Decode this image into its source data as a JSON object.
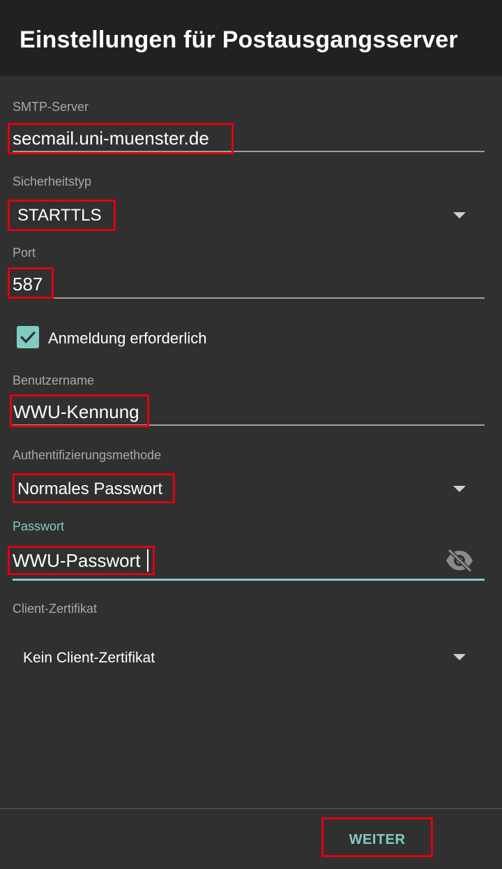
{
  "appbar": {
    "title": "Einstellungen für Postausgangsserver"
  },
  "form": {
    "smtp_server": {
      "label": "SMTP-Server",
      "value": "secmail.uni-muenster.de"
    },
    "security_type": {
      "label": "Sicherheitstyp",
      "value": "STARTTLS"
    },
    "port": {
      "label": "Port",
      "value": "587"
    },
    "login_required": {
      "label": "Anmeldung erforderlich",
      "checked": true
    },
    "username": {
      "label": "Benutzername",
      "value": "WWU-Kennung"
    },
    "auth_method": {
      "label": "Authentifizierungsmethode",
      "value": "Normales Passwort"
    },
    "password": {
      "label": "Passwort",
      "value": "WWU-Passwort",
      "toggle_icon": "visibility-off-icon"
    },
    "client_cert": {
      "label": "Client-Zertifikat",
      "value": "Kein Client-Zertifikat"
    }
  },
  "footer": {
    "next_label": "WEITER"
  },
  "colors": {
    "accent": "#80cbc4",
    "highlight": "#e0000f",
    "background": "#303030",
    "appbar": "#212121"
  }
}
